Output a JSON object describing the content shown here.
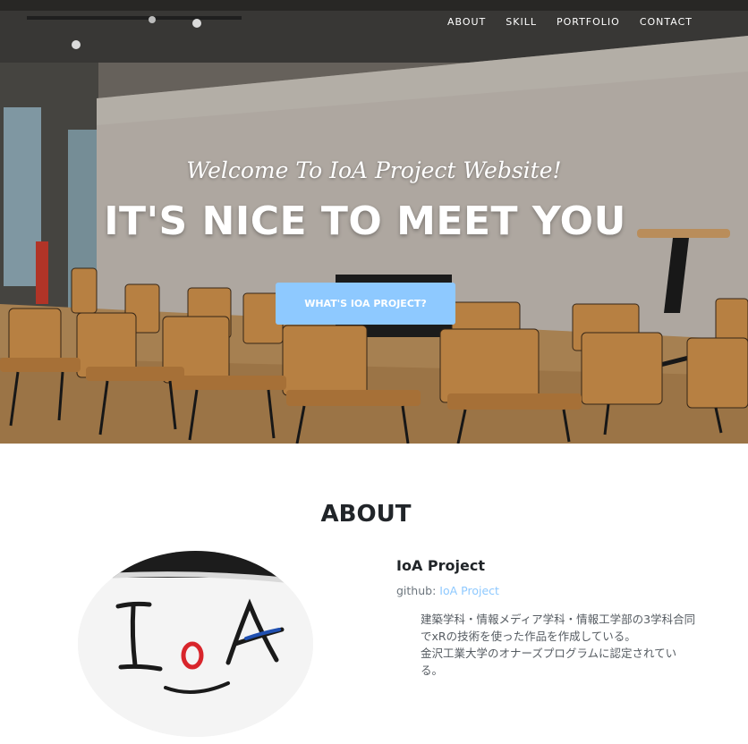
{
  "nav": {
    "items": [
      {
        "label": "ABOUT"
      },
      {
        "label": "SKILL"
      },
      {
        "label": "PORTFOLIO"
      },
      {
        "label": "CONTACT"
      }
    ]
  },
  "hero": {
    "subheading": "Welcome To IoA Project Website!",
    "heading": "IT'S NICE TO MEET YOU",
    "cta_label": "WHAT'S IOA PROJECT?"
  },
  "about": {
    "title": "ABOUT",
    "project_name": "IoA Project",
    "github_prefix": "github:",
    "github_link_label": "IoA Project",
    "description_lines": [
      "建築学科・情報メディア学科・情報工学部の3学科合同でxRの技術を使った作品を作成している。",
      "金沢工業大学のオナーズプログラムに認定されている。"
    ]
  },
  "colors": {
    "accent": "#8ec9ff",
    "text_dark": "#212529",
    "text_muted": "#6c757d"
  }
}
